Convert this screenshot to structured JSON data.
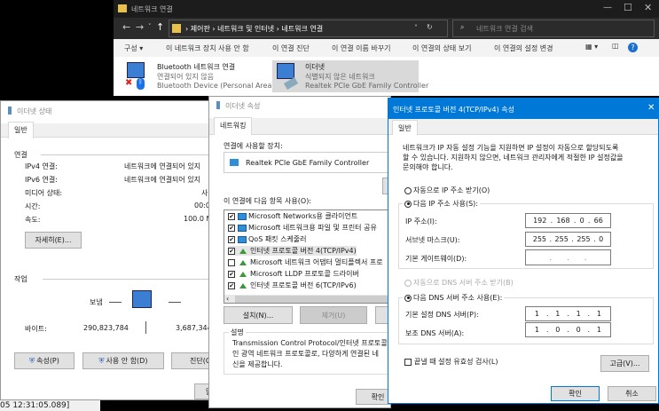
{
  "explorer": {
    "title": "네트워크 연결",
    "breadcrumb": [
      "제어판",
      "네트워크 및 인터넷",
      "네트워크 연결"
    ],
    "search_placeholder": "네트워크 연결 검색",
    "toolbar": [
      "구성 ▾",
      "이 네트워크 장치 사용 안 함",
      "이 연결 진단",
      "이 연결 이름 바꾸기",
      "이 연결의 상태 보기",
      "이 연결의 설정 변경"
    ],
    "items": [
      {
        "name": "Bluetooth 네트워크 연결",
        "status": "연결되어 있지 않음",
        "device": "Bluetooth Device (Personal Area ..."
      },
      {
        "name": "이더넷",
        "status": "식별되지 않은 네트워크",
        "device": "Realtek PCIe GbE Family Controller"
      }
    ]
  },
  "status": {
    "title": "이더넷 상태",
    "tab": "일반",
    "connection_header": "연결",
    "rows": [
      {
        "label": "IPv4 연결:",
        "value": "네트워크에 연결되어 있지"
      },
      {
        "label": "IPv6 연결:",
        "value": "네트워크에 연결되어 있지"
      },
      {
        "label": "미디어 상태:",
        "value": "사"
      },
      {
        "label": "시간:",
        "value": "00:0"
      },
      {
        "label": "속도:",
        "value": "100.0 M"
      }
    ],
    "details_button": "자세히(E)...",
    "activity_header": "작업",
    "sent_label": "보냄",
    "bytes_label": "바이트:",
    "bytes_sent": "290,823,784",
    "bytes_received": "3,687,344",
    "buttons": [
      "속성(P)",
      "사용 안 함(D)",
      "진단(G"
    ],
    "close_button": "닫",
    "timestamp": "05 12:31:05.089]"
  },
  "props": {
    "title": "이더넷 속성",
    "tab": "네트워킹",
    "device_label": "연결에 사용할 장치:",
    "device": "Realtek PCIe GbE Family Controller",
    "items_label": "이 연결에 다음 항목 사용(O):",
    "items": [
      {
        "label": "Microsoft Networks용 클라이언트",
        "checked": true,
        "icon": "net"
      },
      {
        "label": "Microsoft 네트워크용 파일 및 프린터 공유",
        "checked": true,
        "icon": "net"
      },
      {
        "label": "QoS 패킷 스케줄러",
        "checked": true,
        "icon": "net"
      },
      {
        "label": "인터넷 프로토콜 버전 4(TCP/IPv4)",
        "checked": true,
        "icon": "proto"
      },
      {
        "label": "Microsoft 네트워크 어댑터 멀티플렉서 프로",
        "checked": false,
        "icon": "proto"
      },
      {
        "label": "Microsoft LLDP 프로토콜 드라이버",
        "checked": true,
        "icon": "proto"
      },
      {
        "label": "인터넷 프로토콜 버전 6(TCP/IPv6)",
        "checked": true,
        "icon": "proto"
      }
    ],
    "install_button": "설치(N)...",
    "remove_button": "제거(U)",
    "description_header": "설명",
    "description": [
      "Transmission Control Protocol/인터넷 프로토콜입",
      "인 광역 네트워크 프로토콜로, 다양하게 연결된 네",
      "신을 제공합니다."
    ],
    "ok_button": "확인"
  },
  "ipv4": {
    "title": "인터넷 프로토콜 버전 4(TCP/IPv4) 속성",
    "tab": "일반",
    "intro": [
      "네트워크가 IP 자동 설정 기능을 지원하면 IP 설정이 자동으로 할당되도록",
      "할 수 있습니다. 지원하지 않으면, 네트워크 관리자에게 적절한 IP 설정값을",
      "문의해야 합니다."
    ],
    "auto_ip": "자동으로 IP 주소 받기(O)",
    "manual_ip": "다음 IP 주소 사용(S):",
    "ip_label": "IP 주소(I):",
    "ip": [
      "192",
      "168",
      "0",
      "66"
    ],
    "mask_label": "서브넷 마스크(U):",
    "mask": [
      "255",
      "255",
      "255",
      "0"
    ],
    "gateway_label": "기본 게이트웨이(D):",
    "gateway": [
      ".",
      ".",
      "."
    ],
    "auto_dns": "자동으로 DNS 서버 주소 받기(B)",
    "manual_dns": "다음 DNS 서버 주소 사용(E):",
    "dns1_label": "기본 설정 DNS 서버(P):",
    "dns1": [
      "1",
      "1",
      "1",
      "1"
    ],
    "dns2_label": "보조 DNS 서버(A):",
    "dns2": [
      "1",
      "0",
      "0",
      "1"
    ],
    "validate": "끝낼 때 설정 유효성 검사(L)",
    "advanced_button": "고급(V)...",
    "ok_button": "확인",
    "cancel_button": "취소"
  }
}
